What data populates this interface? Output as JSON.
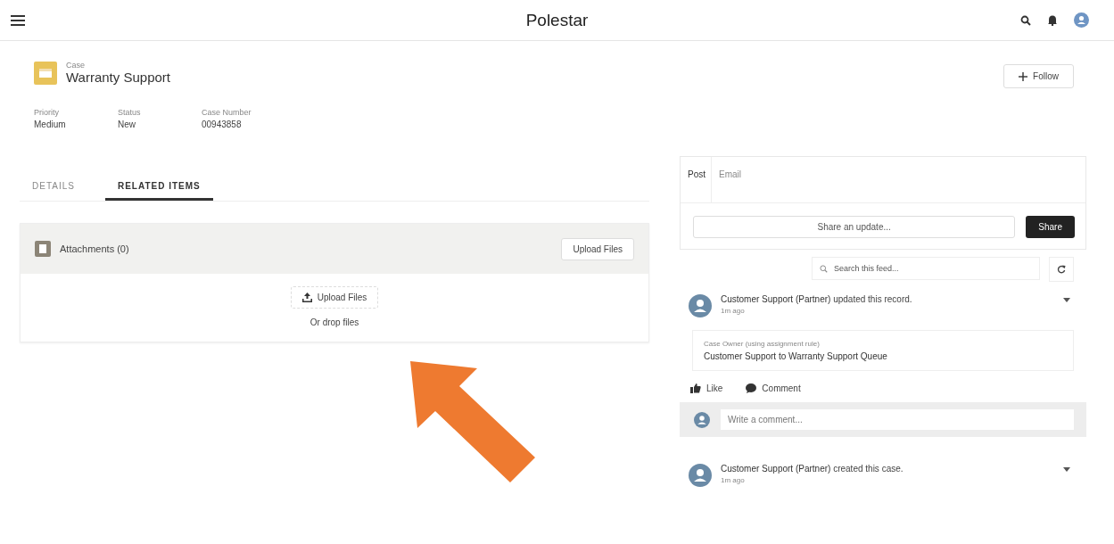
{
  "app": {
    "title": "Polestar"
  },
  "record": {
    "object": "Case",
    "title": "Warranty Support",
    "follow": "Follow",
    "fields": [
      {
        "label": "Priority",
        "value": "Medium"
      },
      {
        "label": "Status",
        "value": "New"
      },
      {
        "label": "Case Number",
        "value": "00943858"
      }
    ]
  },
  "tabs": [
    {
      "label": "DETAILS",
      "selected": false
    },
    {
      "label": "RELATED ITEMS",
      "selected": true
    }
  ],
  "attachments": {
    "title": "Attachments (0)",
    "upload_button": "Upload Files",
    "drop_button": "Upload Files",
    "drop_hint": "Or drop files"
  },
  "publisher": {
    "tabs": [
      {
        "label": "Post",
        "selected": true
      },
      {
        "label": "Email",
        "selected": false
      }
    ],
    "placeholder": "Share an update...",
    "share": "Share"
  },
  "feed_search": {
    "placeholder": "Search this feed..."
  },
  "feed": [
    {
      "actor": "Customer Support (Partner)",
      "action": "updated this record.",
      "time": "1m ago",
      "change": {
        "label": "Case Owner (using assignment rule)",
        "value": "Customer Support to Warranty Support Queue"
      },
      "like": "Like",
      "comment": "Comment",
      "comment_placeholder": "Write a comment..."
    },
    {
      "actor": "Customer Support (Partner)",
      "action": "created this case.",
      "time": "1m ago"
    }
  ]
}
